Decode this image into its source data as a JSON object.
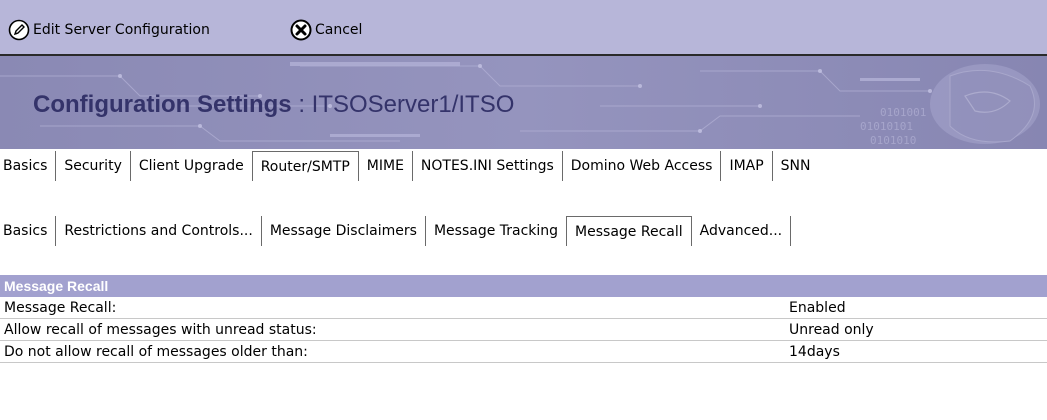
{
  "toolbar": {
    "edit_label": "Edit Server Configuration",
    "edit_icon": "pencil-icon",
    "cancel_label": "Cancel",
    "cancel_icon": "x-circle-icon"
  },
  "banner": {
    "title": "Configuration Settings",
    "separator": " : ",
    "server": "ITSOServer1/ITSO"
  },
  "colors": {
    "toolbar_bg": "#b7b6d9",
    "banner_bg": "#8e8db8",
    "banner_text": "#34336a",
    "section_header_bg": "#a2a1cf"
  },
  "main_tabs": [
    {
      "label": "Basics",
      "active": false
    },
    {
      "label": "Security",
      "active": false
    },
    {
      "label": "Client Upgrade",
      "active": false
    },
    {
      "label": "Router/SMTP",
      "active": true
    },
    {
      "label": "MIME",
      "active": false
    },
    {
      "label": "NOTES.INI Settings",
      "active": false
    },
    {
      "label": "Domino Web Access",
      "active": false
    },
    {
      "label": "IMAP",
      "active": false
    },
    {
      "label": "SNN",
      "active": false
    }
  ],
  "sub_tabs": [
    {
      "label": "Basics",
      "active": false
    },
    {
      "label": "Restrictions and Controls...",
      "active": false
    },
    {
      "label": "Message Disclaimers",
      "active": false
    },
    {
      "label": "Message Tracking",
      "active": false
    },
    {
      "label": "Message Recall",
      "active": true
    },
    {
      "label": "Advanced...",
      "active": false
    }
  ],
  "section": {
    "title": "Message Recall",
    "fields": [
      {
        "label": "Message Recall:",
        "value": "Enabled"
      },
      {
        "label": "Allow recall of messages with unread status:",
        "value": "Unread only"
      },
      {
        "label": "Do not allow recall of messages older than:",
        "value": "14days"
      }
    ]
  }
}
